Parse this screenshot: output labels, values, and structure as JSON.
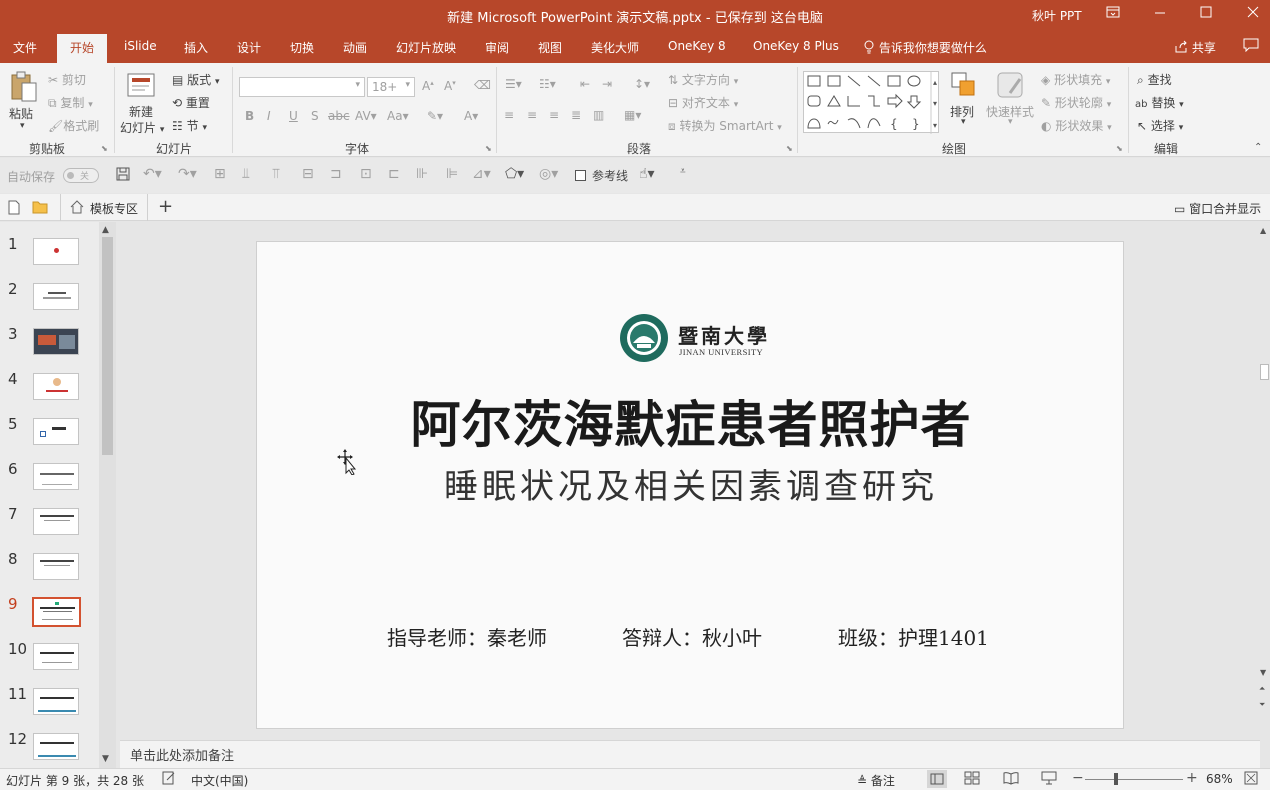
{
  "window": {
    "title": "新建 Microsoft PowerPoint 演示文稿.pptx - 已保存到 这台电脑",
    "user": "秋叶 PPT",
    "accent": "#b7472a"
  },
  "tabs": [
    {
      "label": "文件"
    },
    {
      "label": "开始"
    },
    {
      "label": "iSlide"
    },
    {
      "label": "插入"
    },
    {
      "label": "设计"
    },
    {
      "label": "切换"
    },
    {
      "label": "动画"
    },
    {
      "label": "幻灯片放映"
    },
    {
      "label": "审阅"
    },
    {
      "label": "视图"
    },
    {
      "label": "美化大师"
    },
    {
      "label": "OneKey 8"
    },
    {
      "label": "OneKey 8 Plus"
    }
  ],
  "tell_me": "告诉我你想要做什么",
  "share": "共享",
  "ribbon": {
    "clipboard": {
      "paste": "粘贴",
      "cut": "剪切",
      "copy": "复制",
      "format_painter": "格式刷",
      "label": "剪贴板"
    },
    "slides": {
      "new_slide_1": "新建",
      "new_slide_2": "幻灯片",
      "layout": "版式",
      "reset": "重置",
      "section": "节",
      "label": "幻灯片"
    },
    "font": {
      "size": "18+",
      "label": "字体"
    },
    "paragraph": {
      "text_direction": "文字方向",
      "align_text": "对齐文本",
      "smartart": "转换为 SmartArt",
      "label": "段落"
    },
    "drawing": {
      "arrange": "排列",
      "quick_styles": "快速样式",
      "shape_fill": "形状填充",
      "shape_outline": "形状轮廓",
      "shape_effects": "形状效果",
      "label": "绘图"
    },
    "editing": {
      "find": "查找",
      "replace": "替换",
      "select": "选择",
      "label": "编辑"
    }
  },
  "qat": {
    "autosave": "自动保存",
    "autosave_state": "关",
    "guides": "参考线"
  },
  "strip": {
    "template_tab": "模板专区",
    "merge_windows": "窗口合并显示"
  },
  "thumbnails": [
    "1",
    "2",
    "3",
    "4",
    "5",
    "6",
    "7",
    "8",
    "9",
    "10",
    "11",
    "12"
  ],
  "selected_slide": 9,
  "slide": {
    "logo_cn": "暨南大學",
    "logo_en": "JINAN UNIVERSITY",
    "title": "阿尔茨海默症患者照护者",
    "subtitle": "睡眠状况及相关因素调查研究",
    "advisor": "指导老师：秦老师",
    "presenter": "答辩人：秋小叶",
    "class": "班级：护理1401"
  },
  "notes_placeholder": "单击此处添加备注",
  "status": {
    "slide_info": "幻灯片 第 9 张，共 28 张",
    "language": "中文(中国)",
    "notes_btn": "备注",
    "zoom": "68%"
  }
}
